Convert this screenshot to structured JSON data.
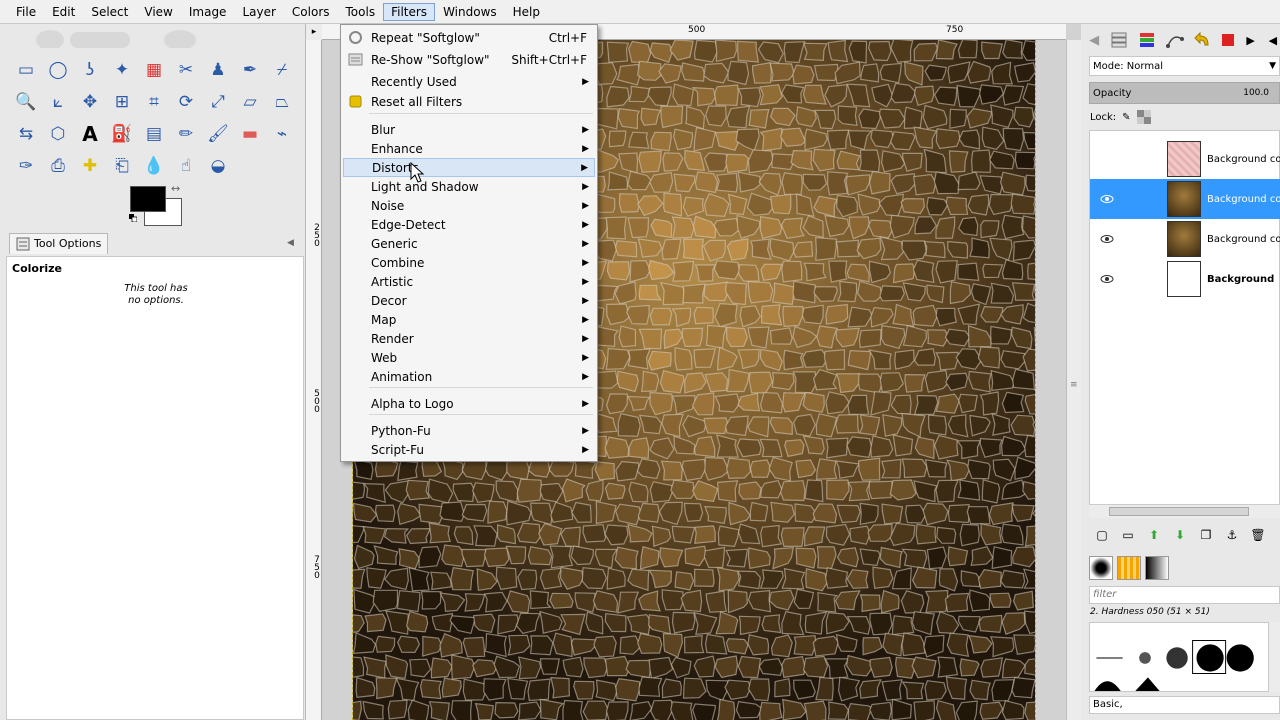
{
  "menubar": {
    "items": [
      "File",
      "Edit",
      "Select",
      "View",
      "Image",
      "Layer",
      "Colors",
      "Tools",
      "Filters",
      "Windows",
      "Help"
    ]
  },
  "toolbox": {
    "tools": [
      "rect-select",
      "ellipse-select",
      "free-select",
      "fuzzy-select",
      "select-by-color",
      "scissors-select",
      "foreground-select",
      "paths",
      "color-picker",
      "zoom",
      "measure",
      "move",
      "align",
      "crop",
      "rotate",
      "scale",
      "shear",
      "perspective",
      "flip",
      "cage-transform",
      "text",
      "bucket-fill",
      "blend",
      "pencil",
      "paintbrush",
      "eraser",
      "airbrush",
      "ink",
      "clone",
      "heal",
      "perspective-clone",
      "blur-sharpen",
      "smudge",
      "dodge-burn"
    ]
  },
  "tool_options": {
    "tab_label": "Tool Options",
    "title": "Colorize",
    "note_line1": "This tool has",
    "note_line2": "no options."
  },
  "ruler": {
    "top_labels": [
      "500",
      "750"
    ],
    "left_labels": [
      {
        "digits": [
          "2",
          "5",
          "0"
        ]
      },
      {
        "digits": [
          "5",
          "0",
          "0"
        ]
      },
      {
        "digits": [
          "7",
          "5",
          "0"
        ]
      }
    ]
  },
  "filters_menu": {
    "items": [
      {
        "label": "Repeat \"Softglow\"",
        "accel": "Ctrl+F",
        "icon": "repeat-icon"
      },
      {
        "label": "Re-Show \"Softglow\"",
        "accel": "Shift+Ctrl+F",
        "icon": "reshow-icon"
      },
      {
        "label": "Recently Used",
        "submenu": true
      },
      {
        "label": "Reset all Filters",
        "icon": "reset-icon"
      },
      {
        "label": "Blur",
        "submenu": true
      },
      {
        "label": "Enhance",
        "submenu": true
      },
      {
        "label": "Distorts",
        "submenu": true,
        "highlighted": true
      },
      {
        "label": "Light and Shadow",
        "submenu": true
      },
      {
        "label": "Noise",
        "submenu": true
      },
      {
        "label": "Edge-Detect",
        "submenu": true
      },
      {
        "label": "Generic",
        "submenu": true
      },
      {
        "label": "Combine",
        "submenu": true
      },
      {
        "label": "Artistic",
        "submenu": true
      },
      {
        "label": "Decor",
        "submenu": true
      },
      {
        "label": "Map",
        "submenu": true
      },
      {
        "label": "Render",
        "submenu": true
      },
      {
        "label": "Web",
        "submenu": true
      },
      {
        "label": "Animation",
        "submenu": true
      },
      {
        "label": "Alpha to Logo",
        "submenu": true
      },
      {
        "label": "Python-Fu",
        "submenu": true
      },
      {
        "label": "Script-Fu",
        "submenu": true
      }
    ]
  },
  "layers_panel": {
    "mode_label": "Mode: Normal",
    "opacity_label": "Opacity",
    "opacity_value": "100.0",
    "lock_label": "Lock:",
    "layers": [
      {
        "name": "Background cop",
        "visible": false,
        "selected": false,
        "thumb": "pink"
      },
      {
        "name": "Background cop",
        "visible": true,
        "selected": true,
        "thumb": "mosaic"
      },
      {
        "name": "Background cop",
        "visible": true,
        "selected": false,
        "thumb": "mosaic"
      },
      {
        "name": "Background",
        "visible": true,
        "selected": false,
        "thumb": "white",
        "bold": true
      }
    ]
  },
  "brushes_panel": {
    "filter_placeholder": "filter",
    "brush_name": "2. Hardness 050 (51 × 51)",
    "preset": "Basic,"
  },
  "colors": {
    "foreground": "#000000",
    "background": "#ffffff",
    "selection": "#3399ff",
    "menu_highlight": "#d8e6f6"
  }
}
